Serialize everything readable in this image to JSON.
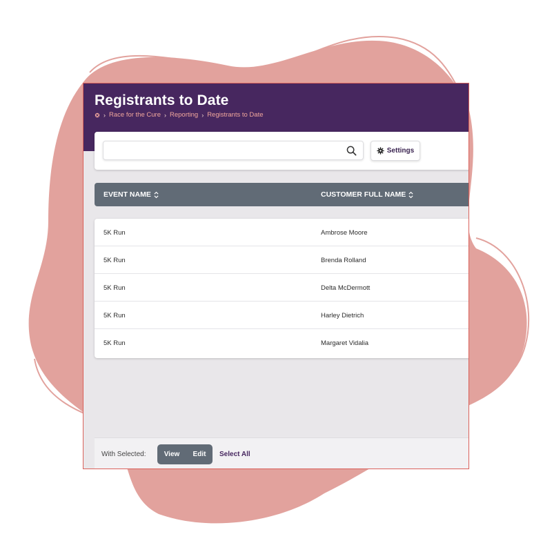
{
  "header": {
    "title": "Registrants to Date",
    "breadcrumb": [
      "Race for the Cure",
      "Reporting",
      "Registrants to Date"
    ]
  },
  "search": {
    "value": "",
    "placeholder": ""
  },
  "settings_label": "Settings",
  "table": {
    "columns": [
      "EVENT NAME",
      "CUSTOMER FULL NAME"
    ],
    "rows": [
      {
        "event": "5K Run",
        "customer": "Ambrose Moore"
      },
      {
        "event": "5K Run",
        "customer": "Brenda Rolland"
      },
      {
        "event": "5K Run",
        "customer": "Delta McDermott"
      },
      {
        "event": "5K Run",
        "customer": "Harley Dietrich"
      },
      {
        "event": "5K Run",
        "customer": "Margaret Vidalia"
      }
    ]
  },
  "footer": {
    "with_selected": "With Selected:",
    "view_label": "View",
    "edit_label": "Edit",
    "select_all_label": "Select All"
  },
  "colors": {
    "header_bg": "#47275f",
    "breadcrumb_text": "#f0a79c",
    "table_header_bg": "#616b76",
    "blob": "#e2a29d"
  }
}
